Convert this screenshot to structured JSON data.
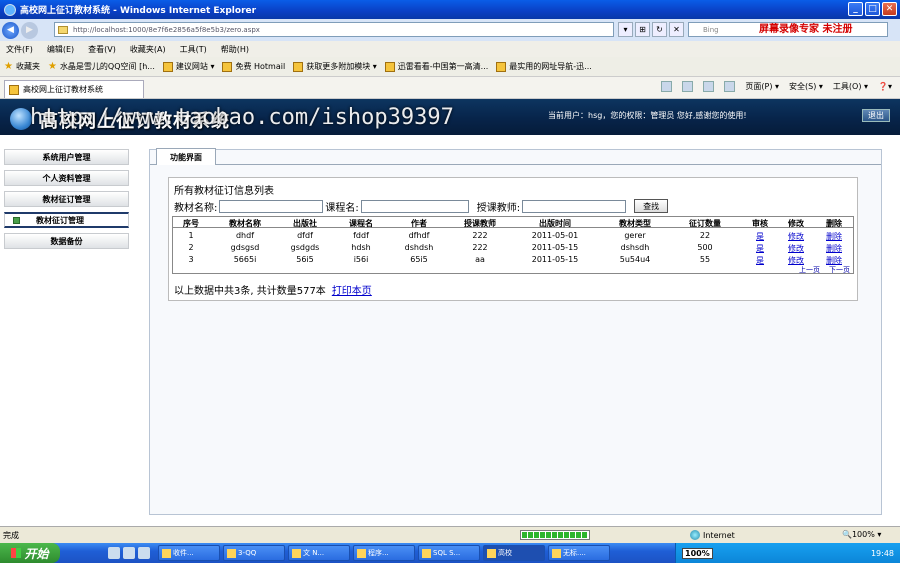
{
  "window": {
    "title": "高校网上征订教材系统 - Windows Internet Explorer",
    "min": "_",
    "max": "□",
    "close": "✕"
  },
  "address": {
    "url": "http://localhost:1000/8e7f6e2856a5f8e5b3/zero.aspx",
    "search_placeholder": "Bing",
    "recorder": "屏幕录像专家 未注册"
  },
  "menu": [
    "文件(F)",
    "编辑(E)",
    "查看(V)",
    "收藏夹(A)",
    "工具(T)",
    "帮助(H)"
  ],
  "favorites": [
    "收藏夹",
    "水晶是雪儿的QQ空间 [h...",
    "建议网站 ▾",
    "免费 Hotmail",
    "获取更多附加模块 ▾",
    "迅雷看看-中国第一高清...",
    "最实用的网址导航-迅..."
  ],
  "browser_tab": "高校网上征订教材系统",
  "command_bar": [
    "页面(P) ▾",
    "安全(S) ▾",
    "工具(O) ▾",
    "❓▾"
  ],
  "header": {
    "site_title": "高校网上征订教材系统",
    "watermark": "http://www.taobao.com/ishop39397",
    "user_info": "当前用户：hsg，您的权限：管理员 您好,感谢您的使用!",
    "logout": "退出"
  },
  "sidebar": [
    "系统用户管理",
    "个人资料管理",
    "教材征订管理",
    "教材征订管理",
    "数据备份"
  ],
  "main": {
    "tab": "功能界面",
    "panel_title": "所有教材征订信息列表",
    "search": {
      "label1": "教材名称:",
      "label2": "课程名:",
      "label3": "授课教师:",
      "button": "查找"
    },
    "columns": [
      "序号",
      "教材名称",
      "出版社",
      "课程名",
      "作者",
      "授课教师",
      "出版时间",
      "教材类型",
      "征订数量",
      "审核",
      "修改",
      "删除"
    ],
    "rows": [
      [
        "1",
        "dhdf",
        "dfdf",
        "fddf",
        "dfhdf",
        "222",
        "2011-05-01",
        "gerer",
        "22",
        "是",
        "修改",
        "删除"
      ],
      [
        "2",
        "gdsgsd",
        "gsdgds",
        "hdsh",
        "dshdsh",
        "222",
        "2011-05-15",
        "dshsdh",
        "500",
        "是",
        "修改",
        "删除"
      ],
      [
        "3",
        "5665i",
        "56i5",
        "i56i",
        "65i5",
        "aa",
        "2011-05-15",
        "5u54u4",
        "55",
        "是",
        "修改",
        "删除"
      ]
    ],
    "prev": "上一页",
    "next": "下一页",
    "summary": "以上数据中共3条, 共计数量577本",
    "print": "打印本页"
  },
  "status": {
    "done": "完成",
    "zone": "Internet",
    "zoom": "🔍100% ▾"
  },
  "taskbar": {
    "start": "开始",
    "tasks": [
      "收件...",
      "3-QQ",
      "文 N...",
      "程序...",
      "SQL S...",
      "高校",
      "无标...."
    ],
    "ime": "100%",
    "clock": "19:48"
  }
}
